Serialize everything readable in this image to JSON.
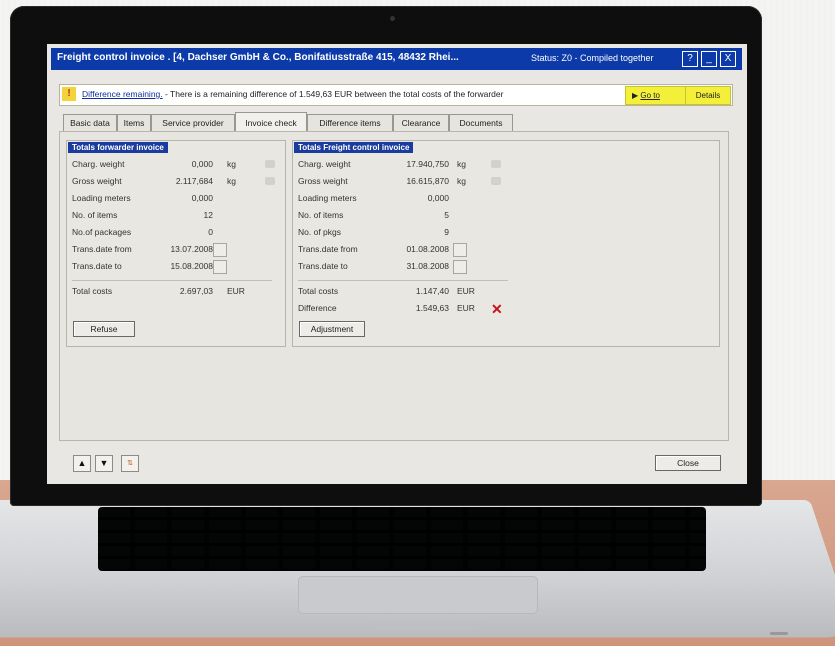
{
  "window": {
    "title": "Freight control invoice . [4, Dachser GmbH & Co., Bonifatiusstraße 415, 48432 Rhei...",
    "status": "Status: Z0 - Compiled together",
    "buttons": {
      "help": "?",
      "minimize": "_",
      "close": "X"
    }
  },
  "message": {
    "link": "Difference remaining.",
    "text": " - There is a remaining difference of 1.549,63 EUR between the total costs of the forwarder",
    "goto_label": "Go to",
    "details_label": "Details"
  },
  "tabs": [
    {
      "label": "Basic data",
      "active": false
    },
    {
      "label": "Items",
      "active": false
    },
    {
      "label": "Service provider",
      "active": false
    },
    {
      "label": "Invoice check",
      "active": true
    },
    {
      "label": "Difference items",
      "active": false
    },
    {
      "label": "Clearance",
      "active": false
    },
    {
      "label": "Documents",
      "active": false
    }
  ],
  "forwarder": {
    "title": "Totals forwarder invoice",
    "charg_weight_label": "Charg. weight",
    "charg_weight_value": "0,000",
    "charg_weight_unit": "kg",
    "gross_weight_label": "Gross weight",
    "gross_weight_value": "2.117,684",
    "gross_weight_unit": "kg",
    "loading_meters_label": "Loading meters",
    "loading_meters_value": "0,000",
    "items_label": "No. of items",
    "items_value": "12",
    "packages_label": "No.of packages",
    "packages_value": "0",
    "date_from_label": "Trans.date from",
    "date_from_value": "13.07.2008",
    "date_to_label": "Trans.date to",
    "date_to_value": "15.08.2008",
    "total_costs_label": "Total costs",
    "total_costs_value": "2.697,03",
    "total_costs_unit": "EUR",
    "refuse_label": "Refuse"
  },
  "freight": {
    "title": "Totals Freight control invoice",
    "charg_weight_label": "Charg. weight",
    "charg_weight_value": "17.940,750",
    "charg_weight_unit": "kg",
    "gross_weight_label": "Gross weight",
    "gross_weight_value": "16.615,870",
    "gross_weight_unit": "kg",
    "loading_meters_label": "Loading meters",
    "loading_meters_value": "0,000",
    "items_label": "No. of items",
    "items_value": "5",
    "pkgs_label": "No. of pkgs",
    "pkgs_value": "9",
    "date_from_label": "Trans.date from",
    "date_from_value": "01.08.2008",
    "date_to_label": "Trans.date to",
    "date_to_value": "31.08.2008",
    "total_costs_label": "Total costs",
    "total_costs_value": "1.147,40",
    "total_costs_unit": "EUR",
    "difference_label": "Difference",
    "difference_value": "1.549,63",
    "difference_unit": "EUR",
    "adjustment_label": "Adjustment"
  },
  "bottom": {
    "up_glyph": "▲",
    "down_glyph": "▼",
    "close_label": "Close"
  },
  "colors": {
    "titlebar": "#0c3aa8",
    "group_title": "#1a3c9e",
    "message_button": "#f4f03a",
    "error": "#c8121a"
  }
}
